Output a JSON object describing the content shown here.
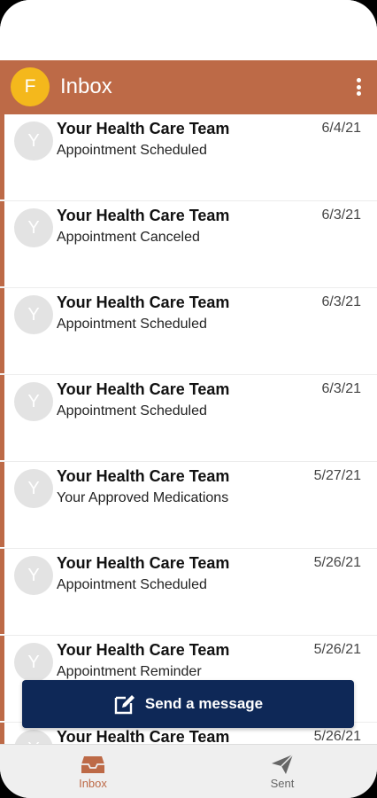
{
  "header": {
    "avatar_letter": "F",
    "title": "Inbox",
    "accent_color": "#bd6a47",
    "avatar_color": "#f4b81c",
    "menu_icon": "kebab-menu-icon"
  },
  "messages": [
    {
      "avatar_letter": "Y",
      "sender": "Your Health Care Team",
      "subject": "Appointment Scheduled",
      "date": "6/4/21"
    },
    {
      "avatar_letter": "Y",
      "sender": "Your Health Care Team",
      "subject": "Appointment Canceled",
      "date": "6/3/21"
    },
    {
      "avatar_letter": "Y",
      "sender": "Your Health Care Team",
      "subject": "Appointment Scheduled",
      "date": "6/3/21"
    },
    {
      "avatar_letter": "Y",
      "sender": "Your Health Care Team",
      "subject": "Appointment Scheduled",
      "date": "6/3/21"
    },
    {
      "avatar_letter": "Y",
      "sender": "Your Health Care Team",
      "subject": "Your Approved Medications",
      "date": "5/27/21"
    },
    {
      "avatar_letter": "Y",
      "sender": "Your Health Care Team",
      "subject": "Appointment Scheduled",
      "date": "5/26/21"
    },
    {
      "avatar_letter": "Y",
      "sender": "Your Health Care Team",
      "subject": "Appointment Reminder",
      "date": "5/26/21"
    },
    {
      "avatar_letter": "Y",
      "sender": "Your Health Care Team",
      "subject": "",
      "date": "5/26/21"
    }
  ],
  "compose": {
    "label": "Send a message",
    "icon": "compose-icon",
    "color": "#0e2857"
  },
  "bottom_nav": {
    "inbox_label": "Inbox",
    "sent_label": "Sent",
    "active_color": "#bd6a47"
  }
}
